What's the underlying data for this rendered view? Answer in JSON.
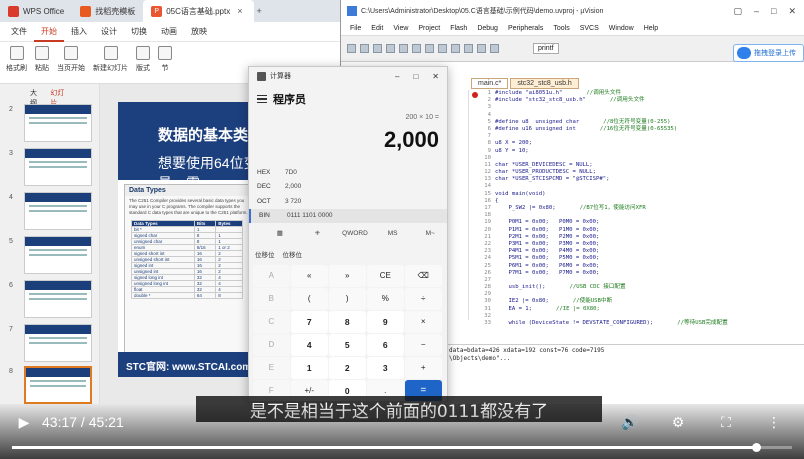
{
  "wps": {
    "tabs": [
      {
        "label": "WPS Office"
      },
      {
        "label": "找稻壳模板"
      },
      {
        "label": "05C语言基础.pptx"
      }
    ],
    "menu": [
      "文件",
      "开始",
      "插入",
      "设计",
      "切换",
      "动画",
      "放映"
    ],
    "ribbon": [
      "格式刷",
      "粘贴",
      "当页开始",
      "新建幻灯片",
      "版式",
      "节"
    ],
    "panel_tabs": [
      "大纲",
      "幻灯片"
    ],
    "thumb_numbers": [
      "2",
      "3",
      "4",
      "5",
      "6",
      "7",
      "8"
    ],
    "slide": {
      "title": "数据的基本类型",
      "subtitle": "想要使用64位变量，需",
      "card_title": "Data Types",
      "card_text": "The C251 Compiler provides several basic data types you may use in your C programs. The compiler supports the standard C data types that are unique to the C251 platform.",
      "table_header": [
        "Data Types",
        "Bits",
        "Bytes"
      ],
      "table_rows": [
        [
          "bit *",
          "1",
          ""
        ],
        [
          "signed char",
          "8",
          "1"
        ],
        [
          "unsigned char",
          "8",
          "1"
        ],
        [
          "enum",
          "8/16",
          "1 or 2"
        ],
        [
          "signed short int",
          "16",
          "2"
        ],
        [
          "unsigned short int",
          "16",
          "2"
        ],
        [
          "signed int",
          "16",
          "2"
        ],
        [
          "unsigned int",
          "16",
          "2"
        ],
        [
          "signed long int",
          "32",
          "4"
        ],
        [
          "unsigned long int",
          "32",
          "4"
        ],
        [
          "float",
          "32",
          "4"
        ],
        [
          "double *",
          "64",
          "8"
        ]
      ],
      "footer": "STC官网: www.STCAI.com"
    }
  },
  "keil": {
    "title": "C:\\Users\\Administrator\\Desktop\\05.C语言基础\\示例代码\\demo.uvproj - µVision",
    "menu": [
      "File",
      "Edit",
      "View",
      "Project",
      "Flash",
      "Debug",
      "Peripherals",
      "Tools",
      "SVCS",
      "Window",
      "Help"
    ],
    "target": "printf",
    "editor_tabs": [
      "main.c*",
      "stc32_stc8_usb.h"
    ],
    "code": [
      {
        "n": "1",
        "t": "#include \"ai8051u.h\"",
        "c": "//调用头文件"
      },
      {
        "n": "2",
        "t": "#include \"stc32_stc8_usb.h\"",
        "c": "//调用头文件"
      },
      {
        "n": "3",
        "t": "",
        "c": ""
      },
      {
        "n": "4",
        "t": "",
        "c": ""
      },
      {
        "n": "5",
        "t": "#define u8  unsigned char",
        "c": "//8位无符号变量(0-255)"
      },
      {
        "n": "6",
        "t": "#define u16 unsigned int",
        "c": "//16位无符号变量(0-65535)"
      },
      {
        "n": "7",
        "t": "",
        "c": ""
      },
      {
        "n": "8",
        "t": "u8 X = 200;",
        "c": ""
      },
      {
        "n": "9",
        "t": "u8 Y = 10;",
        "c": ""
      },
      {
        "n": "10",
        "t": "",
        "c": ""
      },
      {
        "n": "11",
        "t": "char *USER_DEVICEDESC = NULL;",
        "c": ""
      },
      {
        "n": "12",
        "t": "char *USER_PRODUCTDESC = NULL;",
        "c": ""
      },
      {
        "n": "13",
        "t": "char *USER_STCISPCMD = \"@STCISP#\";",
        "c": ""
      },
      {
        "n": "14",
        "t": "",
        "c": ""
      },
      {
        "n": "15",
        "t": "void main(void)",
        "c": ""
      },
      {
        "n": "16",
        "t": "{",
        "c": ""
      },
      {
        "n": "17",
        "t": "    P_SW2 |= 0x80;",
        "c": "//B7位写1，使能访问XFR"
      },
      {
        "n": "18",
        "t": "",
        "c": ""
      },
      {
        "n": "19",
        "t": "    P0M1 = 0x00;   P0M0 = 0x00;",
        "c": ""
      },
      {
        "n": "20",
        "t": "    P1M1 = 0x00;   P1M0 = 0x00;",
        "c": ""
      },
      {
        "n": "21",
        "t": "    P2M1 = 0x00;   P2M0 = 0x00;",
        "c": ""
      },
      {
        "n": "22",
        "t": "    P3M1 = 0x00;   P3M0 = 0x00;",
        "c": ""
      },
      {
        "n": "23",
        "t": "    P4M1 = 0x00;   P4M0 = 0x00;",
        "c": ""
      },
      {
        "n": "24",
        "t": "    P5M1 = 0x00;   P5M0 = 0x00;",
        "c": ""
      },
      {
        "n": "25",
        "t": "    P6M1 = 0x00;   P6M0 = 0x00;",
        "c": ""
      },
      {
        "n": "26",
        "t": "    P7M1 = 0x00;   P7M0 = 0x00;",
        "c": ""
      },
      {
        "n": "27",
        "t": "",
        "c": ""
      },
      {
        "n": "28",
        "t": "    usb_init();",
        "c": "//USB CDC 接口配置"
      },
      {
        "n": "29",
        "t": "",
        "c": ""
      },
      {
        "n": "30",
        "t": "    IE2 |= 0x80;",
        "c": "//使能USB中断"
      },
      {
        "n": "31",
        "t": "    EA = 1;",
        "c": "//IE |= 0X80;"
      },
      {
        "n": "32",
        "t": "",
        "c": ""
      },
      {
        "n": "33",
        "t": "    while (DeviceState != DEVSTATE_CONFIGURED);",
        "c": "//等待USB完成配置"
      }
    ],
    "build_output": [
      "data=bdata=426 xdata=192 const=76 code=7195",
      "\\Objects\\demo\"..."
    ],
    "cloud_label": "拖拽登录上传"
  },
  "calculator": {
    "title": "计算器",
    "mode": "程序员",
    "expression": "200 × 10 =",
    "display": "2,000",
    "radix": [
      {
        "name": "HEX",
        "value": "7D0"
      },
      {
        "name": "DEC",
        "value": "2,000"
      },
      {
        "name": "OCT",
        "value": "3 720"
      },
      {
        "name": "BIN",
        "value": "0111 1101 0000"
      }
    ],
    "tools": [
      "▦",
      "⁜",
      "QWORD",
      "MS",
      "M~"
    ],
    "bitops": [
      "位移位",
      "位移位"
    ],
    "keys": [
      "A",
      "«",
      "»",
      "CE",
      "⌫",
      "B",
      "(",
      ")",
      "%",
      "÷",
      "C",
      "7",
      "8",
      "9",
      "×",
      "D",
      "4",
      "5",
      "6",
      "−",
      "E",
      "1",
      "2",
      "3",
      "+",
      "F",
      "+/-",
      "0",
      ".",
      "="
    ]
  },
  "subtitle": "是不是相当于这个前面的0111都没有了",
  "player": {
    "time": "43:17 / 45:21",
    "progress_fraction": 0.954
  }
}
